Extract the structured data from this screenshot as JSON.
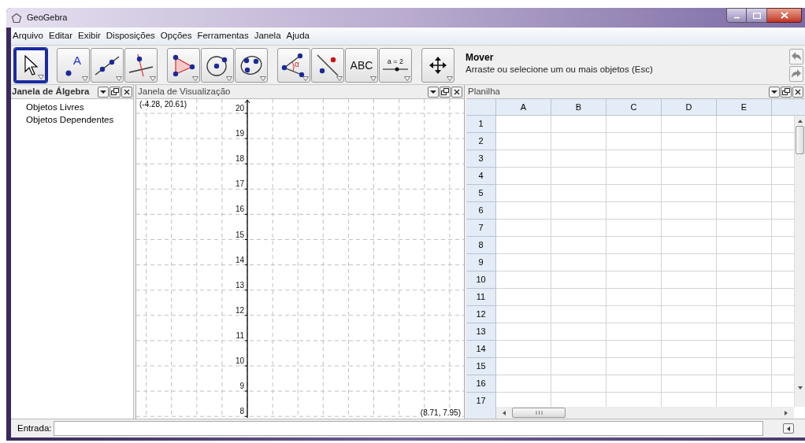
{
  "window": {
    "title": "GeoGebra"
  },
  "menu": [
    "Arquivo",
    "Editar",
    "Exibir",
    "Disposições",
    "Opções",
    "Ferramentas",
    "Janela",
    "Ajuda"
  ],
  "toolbar": {
    "groups": [
      {
        "tools": [
          {
            "kind": "move",
            "selected": true
          }
        ]
      },
      {
        "tools": [
          {
            "kind": "point",
            "label": "A",
            "selected": false
          },
          {
            "kind": "line",
            "selected": false
          },
          {
            "kind": "perpendicular",
            "selected": false
          }
        ]
      },
      {
        "tools": [
          {
            "kind": "polygon",
            "selected": false
          },
          {
            "kind": "circle",
            "selected": false
          },
          {
            "kind": "conic",
            "selected": false
          }
        ]
      },
      {
        "tools": [
          {
            "kind": "angle",
            "label": "α",
            "selected": false
          },
          {
            "kind": "reflect",
            "selected": false
          },
          {
            "kind": "text",
            "label": "ABC",
            "selected": false
          },
          {
            "kind": "slider",
            "label": "a = 2",
            "selected": false
          }
        ]
      },
      {
        "tools": [
          {
            "kind": "move-view",
            "selected": false
          }
        ]
      }
    ],
    "tool_name": "Mover",
    "tool_help": "Arraste ou selecione um ou mais objetos (Esc)"
  },
  "algebra": {
    "title": "Janela de Álgebra",
    "items": [
      "Objetos Livres",
      "Objetos Dependentes"
    ]
  },
  "graphics": {
    "title": "Janela de Visualização",
    "top_left": "(-4.28, 20.61)",
    "bottom_right": "(8.71, 7.95)",
    "y_labels": [
      "20",
      "19",
      "18",
      "17",
      "16",
      "15",
      "14",
      "13",
      "12",
      "11",
      "10",
      "9",
      "8"
    ]
  },
  "spreadsheet": {
    "title": "Planilha",
    "columns": [
      "A",
      "B",
      "C",
      "D",
      "E"
    ],
    "rows": [
      "1",
      "2",
      "3",
      "4",
      "5",
      "6",
      "7",
      "8",
      "9",
      "10",
      "11",
      "12",
      "13",
      "14",
      "15",
      "16",
      "17"
    ]
  },
  "input": {
    "label": "Entrada:"
  }
}
